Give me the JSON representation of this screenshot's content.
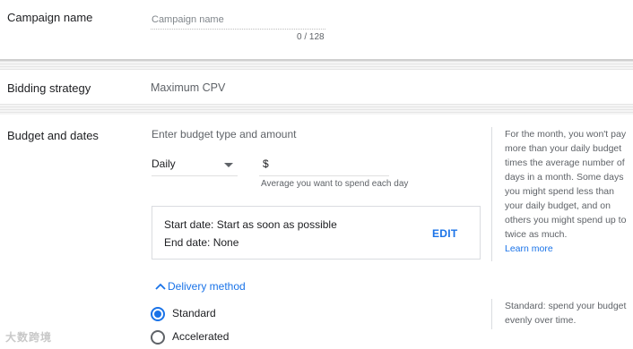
{
  "campaign_name": {
    "label": "Campaign name",
    "placeholder": "Campaign name",
    "value": "",
    "counter": "0 / 128"
  },
  "bidding": {
    "label": "Bidding strategy",
    "value": "Maximum CPV"
  },
  "budget": {
    "label": "Budget and dates",
    "prompt": "Enter budget type and amount",
    "type_selected": "Daily",
    "currency": "$",
    "amount": "",
    "amount_helper": "Average you want to spend each day",
    "start_date": "Start date: Start as soon as possible",
    "end_date": "End date: None",
    "edit_label": "EDIT",
    "help_text": "For the month, you won't pay more than your daily budget times the average number of days in a month. Some days you might spend less than your daily budget, and on others you might spend up to twice as much.",
    "learn_more": "Learn more"
  },
  "delivery": {
    "toggle_label": "Delivery method",
    "options": [
      {
        "label": "Standard",
        "selected": true
      },
      {
        "label": "Accelerated",
        "selected": false
      }
    ],
    "help_text": "Standard: spend your budget evenly over time."
  },
  "watermark": "大数跨境",
  "colors": {
    "accent": "#1a73e8",
    "text": "#202124",
    "muted": "#5f6368"
  }
}
